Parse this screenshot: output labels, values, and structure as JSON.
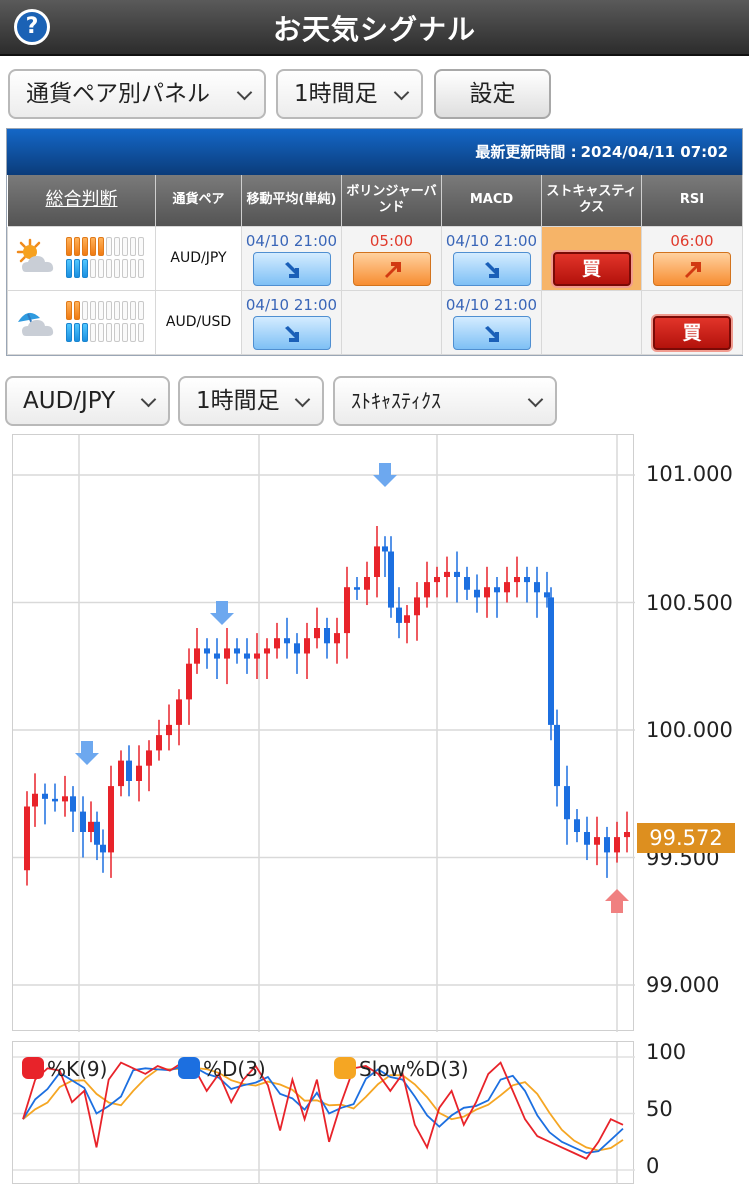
{
  "header": {
    "help_label": "?",
    "title": "お天気シグナル"
  },
  "toolbar": {
    "panel_select": "通貨ペア別パネル",
    "timeframe_select": "1時間足",
    "settings_label": "設定"
  },
  "panel": {
    "update_label": "最新更新時間 :",
    "update_time": "2024/04/11 07:02",
    "headers": [
      "総合判断",
      "通貨ペア",
      "移動平均(単純)",
      "ボリンジャーバンド",
      "MACD",
      "ストキャスティクス",
      "RSI"
    ],
    "rows": [
      {
        "weather": "sunny-cloudy-icon",
        "strength": {
          "orange": 5,
          "blue": 3,
          "total": 10
        },
        "pair": "AUD/JPY",
        "ma": {
          "time": "04/10 21:00",
          "signal": "down"
        },
        "bb": {
          "time": "05:00",
          "signal": "up"
        },
        "macd": {
          "time": "04/10 21:00",
          "signal": "down"
        },
        "stoch": {
          "time": "",
          "signal": "buy",
          "label": "買"
        },
        "rsi": {
          "time": "06:00",
          "signal": "up"
        }
      },
      {
        "weather": "umbrella-cloudy-icon",
        "strength": {
          "orange": 2,
          "blue": 3,
          "total": 10
        },
        "pair": "AUD/USD",
        "ma": {
          "time": "04/10 21:00",
          "signal": "down"
        },
        "bb": {
          "time": "",
          "signal": "none"
        },
        "macd": {
          "time": "04/10 21:00",
          "signal": "down"
        },
        "stoch": {
          "time": "",
          "signal": "none"
        },
        "rsi": {
          "time": "",
          "signal": "buy",
          "label": "買"
        }
      }
    ]
  },
  "chart_controls": {
    "pair_select": "AUD/JPY",
    "timeframe_select": "1時間足",
    "indicator_select": "ｽﾄｷｬｽﾃｨｸｽ"
  },
  "price_axis": {
    "labels": [
      "101.000",
      "100.500",
      "100.000",
      "99.500",
      "99.000"
    ],
    "current": "99.572"
  },
  "oscillator": {
    "axis_labels": [
      "100",
      "50",
      "0"
    ],
    "legend": [
      {
        "name": "%K(9)",
        "color": "#e8232a"
      },
      {
        "name": "%D(3)",
        "color": "#1c6fe0"
      },
      {
        "name": "Slow%D(3)",
        "color": "#f5a623"
      }
    ]
  },
  "colors": {
    "up_candle": "#e8232a",
    "down_candle": "#1c6fe0",
    "accent": "#dd8f1f"
  }
}
